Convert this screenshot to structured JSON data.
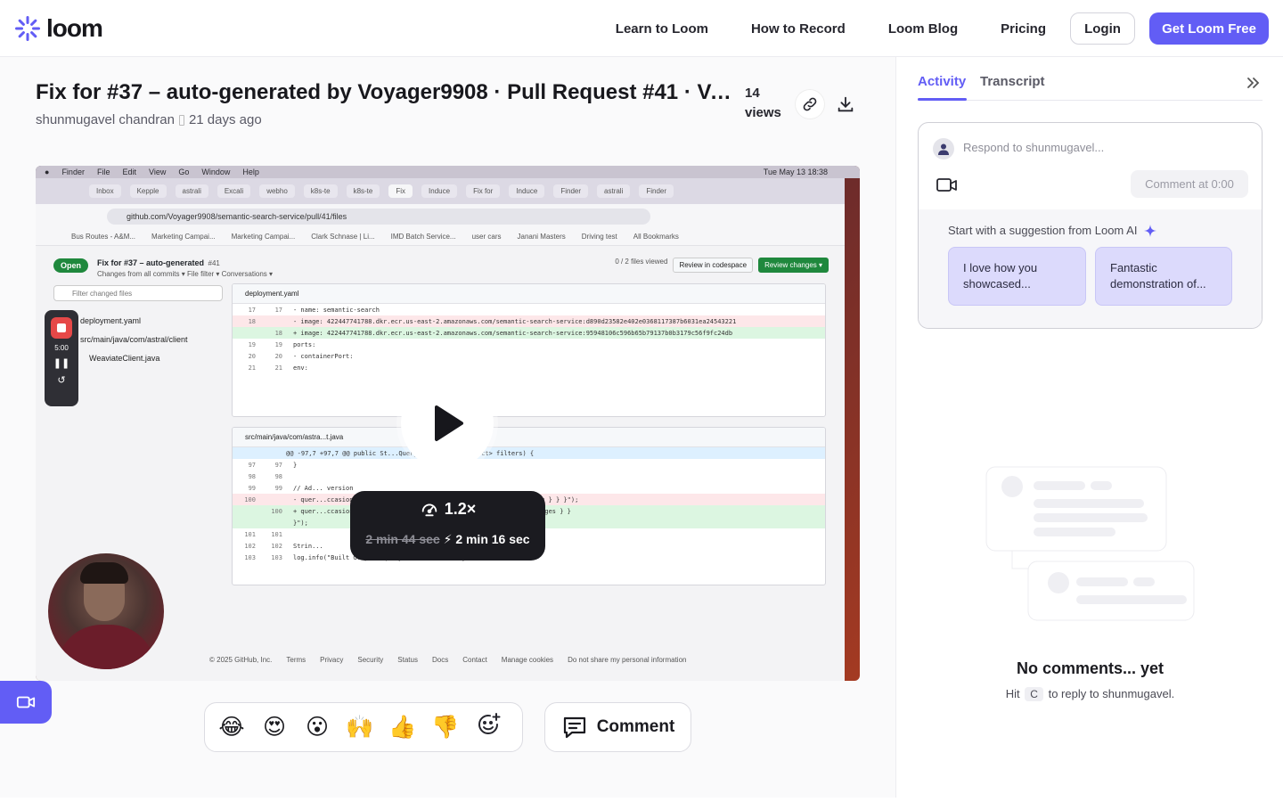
{
  "nav": {
    "logo": "loom",
    "links": [
      "Learn to Loom",
      "How to Record",
      "Loom Blog",
      "Pricing"
    ],
    "login": "Login",
    "cta": "Get Loom Free"
  },
  "video": {
    "title": "Fix for #37 – auto-generated by Voyager9908 · Pull Request #41 · Vo...",
    "author": "shunmugavel chandran",
    "age": "21 days ago",
    "views_count": "14",
    "views_label": "views",
    "speed": "1.2×",
    "original_duration": "2 min 44 sec",
    "fast_duration": "2 min 16 sec"
  },
  "screen": {
    "menu": [
      "Finder",
      "File",
      "Edit",
      "View",
      "Go",
      "Window",
      "Help"
    ],
    "clock": "Tue May 13  18:38",
    "tabs": [
      "Inbox",
      "Kepple",
      "astrali",
      "Excali",
      "webho",
      "k8s-te",
      "k8s-te",
      "Fix",
      "Induce",
      "Fix for",
      "Induce",
      "Finder",
      "astrali",
      "Finder"
    ],
    "url": "github.com/Voyager9908/semantic-search-service/pull/41/files",
    "bookmarks": [
      "Bus Routes - A&M...",
      "Marketing Campai...",
      "Marketing Campai...",
      "Clark Schnase | Li...",
      "IMD Batch Service...",
      "user cars",
      "Janani Masters",
      "Driving test",
      "All Bookmarks"
    ],
    "pr_badge": "Open",
    "pr_title": "Fix for #37 – auto-generated",
    "pr_num": "#41",
    "pr_sub": "Changes from all commits ▾   File filter ▾   Conversations ▾",
    "files_viewed": "0 / 2 files viewed",
    "codespace": "Review in codespace",
    "review": "Review changes ▾",
    "filter": "Filter changed files",
    "files": [
      "deployment.yaml",
      "src/main/java/com/astral/client",
      "WeaviateClient.java"
    ],
    "rec_time": "5:00",
    "diff1_file": "deployment.yaml",
    "diff1": [
      {
        "a": "17",
        "b": "17",
        "t": "        - name: semantic-search",
        "k": ""
      },
      {
        "a": "18",
        "b": "",
        "t": "-         image: 422447741788.dkr.ecr.us-east-2.amazonaws.com/semantic-search-service:d890d23582e402e0368117387b6031ea24543221",
        "k": "del"
      },
      {
        "a": "",
        "b": "18",
        "t": "+         image: 422447741788.dkr.ecr.us-east-2.amazonaws.com/semantic-search-service:95948106c596b65b79137b0b3179c56f9fc24db",
        "k": "add"
      },
      {
        "a": "19",
        "b": "19",
        "t": "          ports:",
        "k": ""
      },
      {
        "a": "20",
        "b": "20",
        "t": "            - containerPort:",
        "k": ""
      },
      {
        "a": "21",
        "b": "21",
        "t": "          env:",
        "k": ""
      }
    ],
    "diff2_file": "src/main/java/com/astra...t.java",
    "diff2_hunk": "@@ -97,7 +97,7 @@ public St...Query(Map<String, Object> filters) {",
    "diff2": [
      {
        "a": "97",
        "b": "97",
        "t": "        }",
        "k": ""
      },
      {
        "a": "98",
        "b": "98",
        "t": "",
        "k": ""
      },
      {
        "a": "99",
        "b": "99",
        "t": "        // Ad...                                   version",
        "k": ""
      },
      {
        "a": "100",
        "b": "",
        "t": "-       quer...ccasion enhanced_description description sizes q_and_a img } } }\");",
        "k": "del"
      },
      {
        "a": "",
        "b": "100",
        "t": "+       quer...ccasion enhanced_description description sizes q_and_a images } }",
        "k": "add"
      },
      {
        "a": "",
        "b": "",
        "t": "}\");",
        "k": "add"
      },
      {
        "a": "101",
        "b": "101",
        "t": "",
        "k": ""
      },
      {
        "a": "102",
        "b": "102",
        "t": "        Strin...",
        "k": ""
      },
      {
        "a": "103",
        "b": "103",
        "t": "        log.info(\"Built GraphQL query: {}\", finalQuery);",
        "k": ""
      }
    ],
    "footer": [
      "© 2025 GitHub, Inc.",
      "Terms",
      "Privacy",
      "Security",
      "Status",
      "Docs",
      "Contact",
      "Manage cookies",
      "Do not share my personal information"
    ]
  },
  "reactions": [
    "😂",
    "😍",
    "😮",
    "🙌",
    "👍",
    "👎"
  ],
  "comment_button": "Comment",
  "sidebar": {
    "tab_activity": "Activity",
    "tab_transcript": "Transcript",
    "placeholder": "Respond to shunmugavel...",
    "comment_at": "Comment at 0:00",
    "ai_label": "Start with a suggestion from Loom AI",
    "suggestions": [
      "I love how you showcased...",
      "Fantastic demonstration of..."
    ],
    "empty_title": "No comments... yet",
    "empty_pre": "Hit",
    "empty_key": "C",
    "empty_post": "to reply to shunmugavel."
  },
  "colors": {
    "accent": "#625df5",
    "suggestion_bg": "#dcdafc"
  }
}
